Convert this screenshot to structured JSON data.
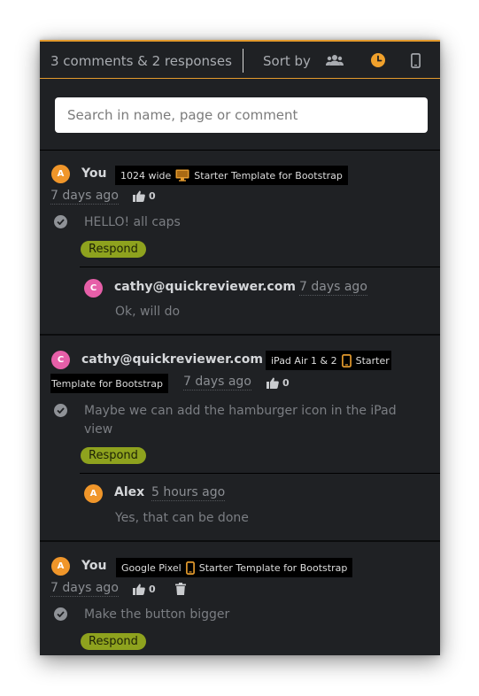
{
  "header": {
    "count_label": "3 comments & 2 responses",
    "sort_label": "Sort by",
    "sort_options": [
      "users-icon",
      "clock-icon",
      "mobile-icon"
    ],
    "accent_color": "#e39a2d"
  },
  "search": {
    "placeholder": "Search in name, page or comment"
  },
  "threads": [
    {
      "author": "You",
      "avatar": "A",
      "page": {
        "size": "1024 wide",
        "device": "desktop-icon",
        "title": "Starter Template for Bootstrap"
      },
      "time": "7 days ago",
      "likes": "0",
      "text": "HELLO! all caps",
      "respond_label": "Respond",
      "reply": {
        "author": "cathy@quickreviewer.com",
        "avatar": "C",
        "time": "7 days ago",
        "text": "Ok, will do"
      }
    },
    {
      "author": "cathy@quickreviewer.com",
      "avatar": "C",
      "page": {
        "size": "iPad Air 1 & 2",
        "device": "tablet-icon",
        "title_a": "Starter",
        "title_b": "Template for Bootstrap"
      },
      "time": "7 days ago",
      "likes": "0",
      "text_line1": "Maybe we can add the hamburger icon in the iPad",
      "text_line2": "view",
      "respond_label": "Respond",
      "reply": {
        "author": "Alex",
        "avatar": "A",
        "time": "5 hours ago",
        "text": "Yes, that can be done"
      }
    },
    {
      "author": "You",
      "avatar": "A",
      "page": {
        "size": "Google Pixel",
        "device": "phone-icon",
        "title": "Starter Template for Bootstrap"
      },
      "time": "7 days ago",
      "likes": "0",
      "text": "Make the button bigger",
      "respond_label": "Respond"
    }
  ]
}
